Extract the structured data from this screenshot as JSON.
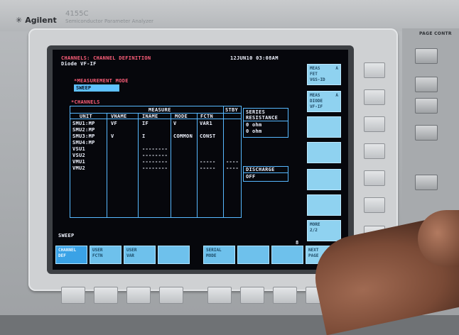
{
  "device": {
    "brand": "Agilent",
    "model": "4155C",
    "model_sub": "Semiconductor Parameter Analyzer",
    "panel_label": "PAGE CONTR"
  },
  "screen": {
    "title": "CHANNELS: CHANNEL DEFINITION",
    "subtitle": "Diode VF-IF",
    "datetime": "12JUN10 03:08AM",
    "measurement_mode_label": "*MEASUREMENT MODE",
    "measurement_mode_value": "SWEEP",
    "channels_label": "*CHANNELS",
    "table": {
      "measure_header": "MEASURE",
      "stby_header": "STBY",
      "columns": [
        "UNIT",
        "VNAME",
        "INAME",
        "MODE",
        "FCTN"
      ],
      "rows": [
        {
          "unit": "SMU1:MP",
          "vname": "VF",
          "iname": "IF",
          "mode": "V",
          "fctn": "VAR1",
          "stby": ""
        },
        {
          "unit": "SMU2:MP",
          "vname": "",
          "iname": "",
          "mode": "",
          "fctn": "",
          "stby": ""
        },
        {
          "unit": "SMU3:MP",
          "vname": "V",
          "iname": "I",
          "mode": "COMMON",
          "fctn": "CONST",
          "stby": ""
        },
        {
          "unit": "SMU4:MP",
          "vname": "",
          "iname": "",
          "mode": "",
          "fctn": "",
          "stby": ""
        },
        {
          "unit": "VSU1",
          "vname": "",
          "iname": "--------",
          "mode": "",
          "fctn": "",
          "stby": ""
        },
        {
          "unit": "VSU2",
          "vname": "",
          "iname": "--------",
          "mode": "",
          "fctn": "",
          "stby": ""
        },
        {
          "unit": "VMU1",
          "vname": "",
          "iname": "--------",
          "mode": "",
          "fctn": "-----",
          "stby": "----"
        },
        {
          "unit": "VMU2",
          "vname": "",
          "iname": "--------",
          "mode": "",
          "fctn": "-----",
          "stby": "----"
        }
      ]
    },
    "series_resistance": {
      "title1": "SERIES",
      "title2": "RESISTANCE",
      "values": [
        "0 ohm",
        "0 ohm"
      ]
    },
    "discharge": {
      "label": "DISCHARGE",
      "value": "OFF"
    },
    "status": "SWEEP",
    "marker": "8",
    "right_keys": [
      {
        "line1": "MEAS",
        "line2": "FET",
        "line3": "VGS-ID",
        "tag": "A"
      },
      {
        "line1": "MEAS",
        "line2": "DIODE",
        "line3": "VF-IF",
        "tag": "A"
      },
      {
        "line1": "",
        "line2": "",
        "line3": "",
        "tag": ""
      },
      {
        "line1": "",
        "line2": "",
        "line3": "",
        "tag": ""
      },
      {
        "line1": "",
        "line2": "",
        "line3": "",
        "tag": ""
      },
      {
        "line1": "",
        "line2": "",
        "line3": "",
        "tag": ""
      },
      {
        "line1": "MORE",
        "line2": "",
        "line3": "2/2",
        "tag": ""
      }
    ],
    "bottom_keys": [
      {
        "line1": "CHANNEL",
        "line2": "DEF"
      },
      {
        "line1": "USER",
        "line2": "FCTN"
      },
      {
        "line1": "USER",
        "line2": "VAR"
      },
      {
        "line1": "",
        "line2": ""
      },
      {
        "line1": "SERIAL",
        "line2": "MODE"
      },
      {
        "line1": "",
        "line2": ""
      },
      {
        "line1": "",
        "line2": ""
      },
      {
        "line1": "NEXT",
        "line2": "PAGE"
      }
    ]
  }
}
